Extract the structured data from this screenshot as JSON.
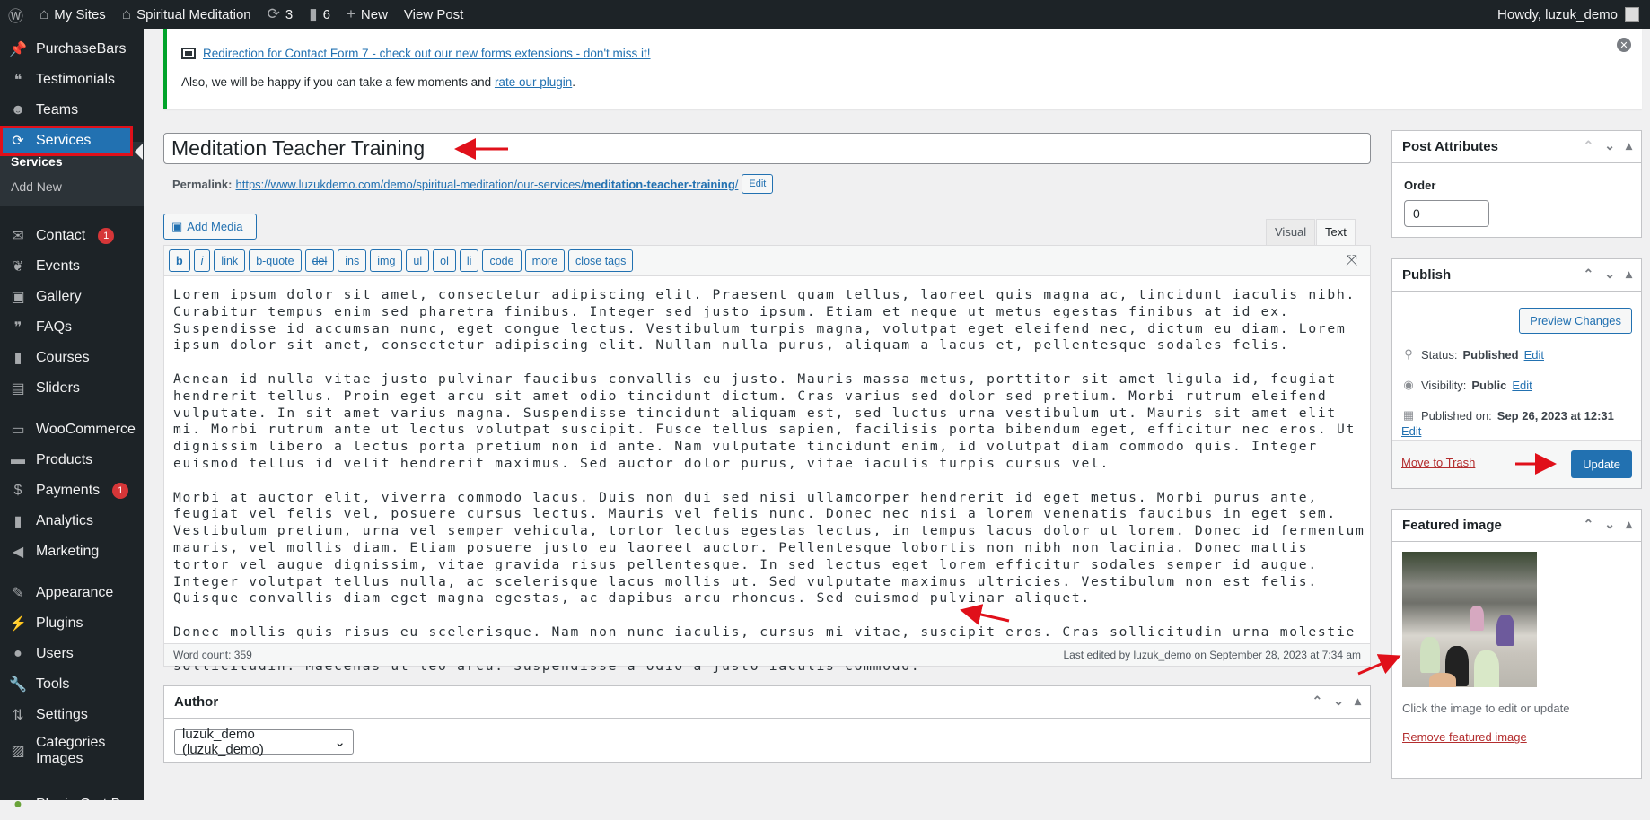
{
  "adminbar": {
    "my_sites": "My Sites",
    "site_name": "Spiritual Meditation",
    "updates_count": "3",
    "comments_count": "6",
    "new_label": "New",
    "view_post": "View Post",
    "howdy": "Howdy, luzuk_demo"
  },
  "sidebar": {
    "items": [
      {
        "label": "PurchaseBars",
        "icon": "pin"
      },
      {
        "label": "Testimonials",
        "icon": "comments"
      },
      {
        "label": "Teams",
        "icon": "groups"
      },
      {
        "label": "Services",
        "icon": "update"
      },
      {
        "label": "Contact",
        "icon": "email",
        "badge": "1"
      },
      {
        "label": "Events",
        "icon": "palm"
      },
      {
        "label": "Gallery",
        "icon": "images"
      },
      {
        "label": "FAQs",
        "icon": "speech"
      },
      {
        "label": "Courses",
        "icon": "book"
      },
      {
        "label": "Sliders",
        "icon": "slides"
      },
      {
        "label": "WooCommerce",
        "icon": "woo"
      },
      {
        "label": "Products",
        "icon": "archive"
      },
      {
        "label": "Payments",
        "icon": "dollar",
        "badge": "1"
      },
      {
        "label": "Analytics",
        "icon": "bar-chart"
      },
      {
        "label": "Marketing",
        "icon": "megaphone"
      },
      {
        "label": "Appearance",
        "icon": "brush"
      },
      {
        "label": "Plugins",
        "icon": "plug"
      },
      {
        "label": "Users",
        "icon": "user"
      },
      {
        "label": "Tools",
        "icon": "wrench"
      },
      {
        "label": "Settings",
        "icon": "sliders"
      },
      {
        "label": "Categories Images",
        "icon": "image"
      },
      {
        "label": "Plugin Cart Bar",
        "icon": "leaf"
      }
    ],
    "submenu": [
      "Services",
      "Add New"
    ]
  },
  "notice": {
    "link_text": "Redirection for Contact Form 7 - check out our new forms extensions - don't miss it!",
    "line2_prefix": "Also, we will be happy if you can take a few moments and ",
    "rate_link": "rate our plugin",
    "line2_suffix": "."
  },
  "post": {
    "title": "Meditation Teacher Training",
    "permalink_label": "Permalink:",
    "permalink_base": "https://www.luzukdemo.com/demo/spiritual-meditation/our-services/",
    "permalink_slug": "meditation-teacher-training",
    "permalink_end": "/",
    "permalink_edit": "Edit"
  },
  "editor": {
    "add_media": "Add Media",
    "tab_visual": "Visual",
    "tab_text": "Text",
    "active_tab": "Text",
    "quicktags": [
      "b",
      "i",
      "link",
      "b-quote",
      "del",
      "ins",
      "img",
      "ul",
      "ol",
      "li",
      "code",
      "more",
      "close tags"
    ],
    "paragraphs": [
      "Lorem ipsum dolor sit amet, consectetur adipiscing elit. Praesent quam tellus, laoreet quis magna ac, tincidunt iaculis nibh. Curabitur tempus enim sed pharetra finibus. Integer sed justo ipsum. Etiam et neque ut metus egestas finibus at id ex. Suspendisse id accumsan nunc, eget congue lectus. Vestibulum turpis magna, volutpat eget eleifend nec, dictum eu diam. Lorem ipsum dolor sit amet, consectetur adipiscing elit. Nullam nulla purus, aliquam a lacus et, pellentesque sodales felis.",
      "Aenean id nulla vitae justo pulvinar faucibus convallis eu justo. Mauris massa metus, porttitor sit amet ligula id, feugiat hendrerit tellus. Proin eget arcu sit amet odio tincidunt dictum. Cras varius sed dolor sed pretium. Morbi rutrum eleifend vulputate. In sit amet varius magna. Suspendisse tincidunt aliquam est, sed luctus urna vestibulum ut. Mauris sit amet elit mi. Morbi rutrum ante ut lectus volutpat suscipit. Fusce tellus sapien, facilisis porta bibendum eget, efficitur nec eros. Ut dignissim libero a lectus porta pretium non id ante. Nam vulputate tincidunt enim, id volutpat diam commodo quis. Integer euismod tellus id velit hendrerit maximus. Sed auctor dolor purus, vitae iaculis turpis cursus vel.",
      "Morbi at auctor elit, viverra commodo lacus. Duis non dui sed nisi ullamcorper hendrerit id eget metus. Morbi purus ante, feugiat vel felis vel, posuere cursus lectus. Mauris vel felis nunc. Donec nec nisi a lorem venenatis faucibus in eget sem. Vestibulum pretium, urna vel semper vehicula, tortor lectus egestas lectus, in tempus lacus dolor ut lorem. Donec id fermentum mauris, vel mollis diam. Etiam posuere justo eu laoreet auctor. Pellentesque lobortis non nibh non lacinia. Donec mattis tortor vel augue dignissim, vitae gravida risus pellentesque. In sed lectus eget lorem efficitur sodales semper id augue. Integer volutpat tellus nulla, ac scelerisque lacus mollis ut. Sed vulputate maximus ultricies. Vestibulum non est felis. Quisque convallis diam eget magna egestas, ac dapibus arcu rhoncus. Sed euismod pulvinar aliquet.",
      "Donec mollis quis risus eu scelerisque. Nam non nunc iaculis, cursus mi vitae, suscipit eros. Cras sollicitudin urna molestie rutrum interdum. Sed varius ligula sit amet nibh dictum, vitae eleifend metus pretium. Integer semper egestas nunc egestas sollicitudin. Maecenas ut leo arcu. Suspendisse a odio a justo iaculis commodo."
    ],
    "word_count": "Word count: 359",
    "last_edited": "Last edited by luzuk_demo on September 28, 2023 at 7:34 am"
  },
  "author_box": {
    "title": "Author",
    "selected": "luzuk_demo (luzuk_demo)"
  },
  "post_attributes": {
    "title": "Post Attributes",
    "order_label": "Order",
    "order_value": "0"
  },
  "publish": {
    "title": "Publish",
    "preview": "Preview Changes",
    "status_label": "Status:",
    "status_value": "Published",
    "visibility_label": "Visibility:",
    "visibility_value": "Public",
    "published_label": "Published on:",
    "published_value": "Sep 26, 2023 at 12:31",
    "edit": "Edit",
    "trash": "Move to Trash",
    "update": "Update"
  },
  "featured_image": {
    "title": "Featured image",
    "hint": "Click the image to edit or update",
    "remove": "Remove featured image"
  },
  "colors": {
    "accent": "#2271b1",
    "sidebar_bg": "#1d2327",
    "annotation_red": "#e0101a",
    "notice_green": "#00a32a"
  }
}
